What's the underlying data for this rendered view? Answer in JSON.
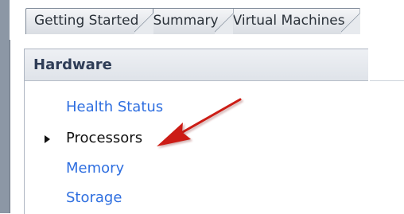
{
  "tabs": {
    "items": [
      "Getting Started",
      "Summary",
      "Virtual Machines"
    ]
  },
  "panel": {
    "title": "Hardware"
  },
  "menu": {
    "items": [
      "Health Status",
      "Processors",
      "Memory",
      "Storage"
    ]
  },
  "colors": {
    "link": "#2f6fe0",
    "selected_text": "#111111",
    "annotation_arrow": "#cc1e12"
  },
  "icons": {
    "selected_bullet": "bullet-triangle-icon",
    "annotation": "red-arrow-icon"
  }
}
